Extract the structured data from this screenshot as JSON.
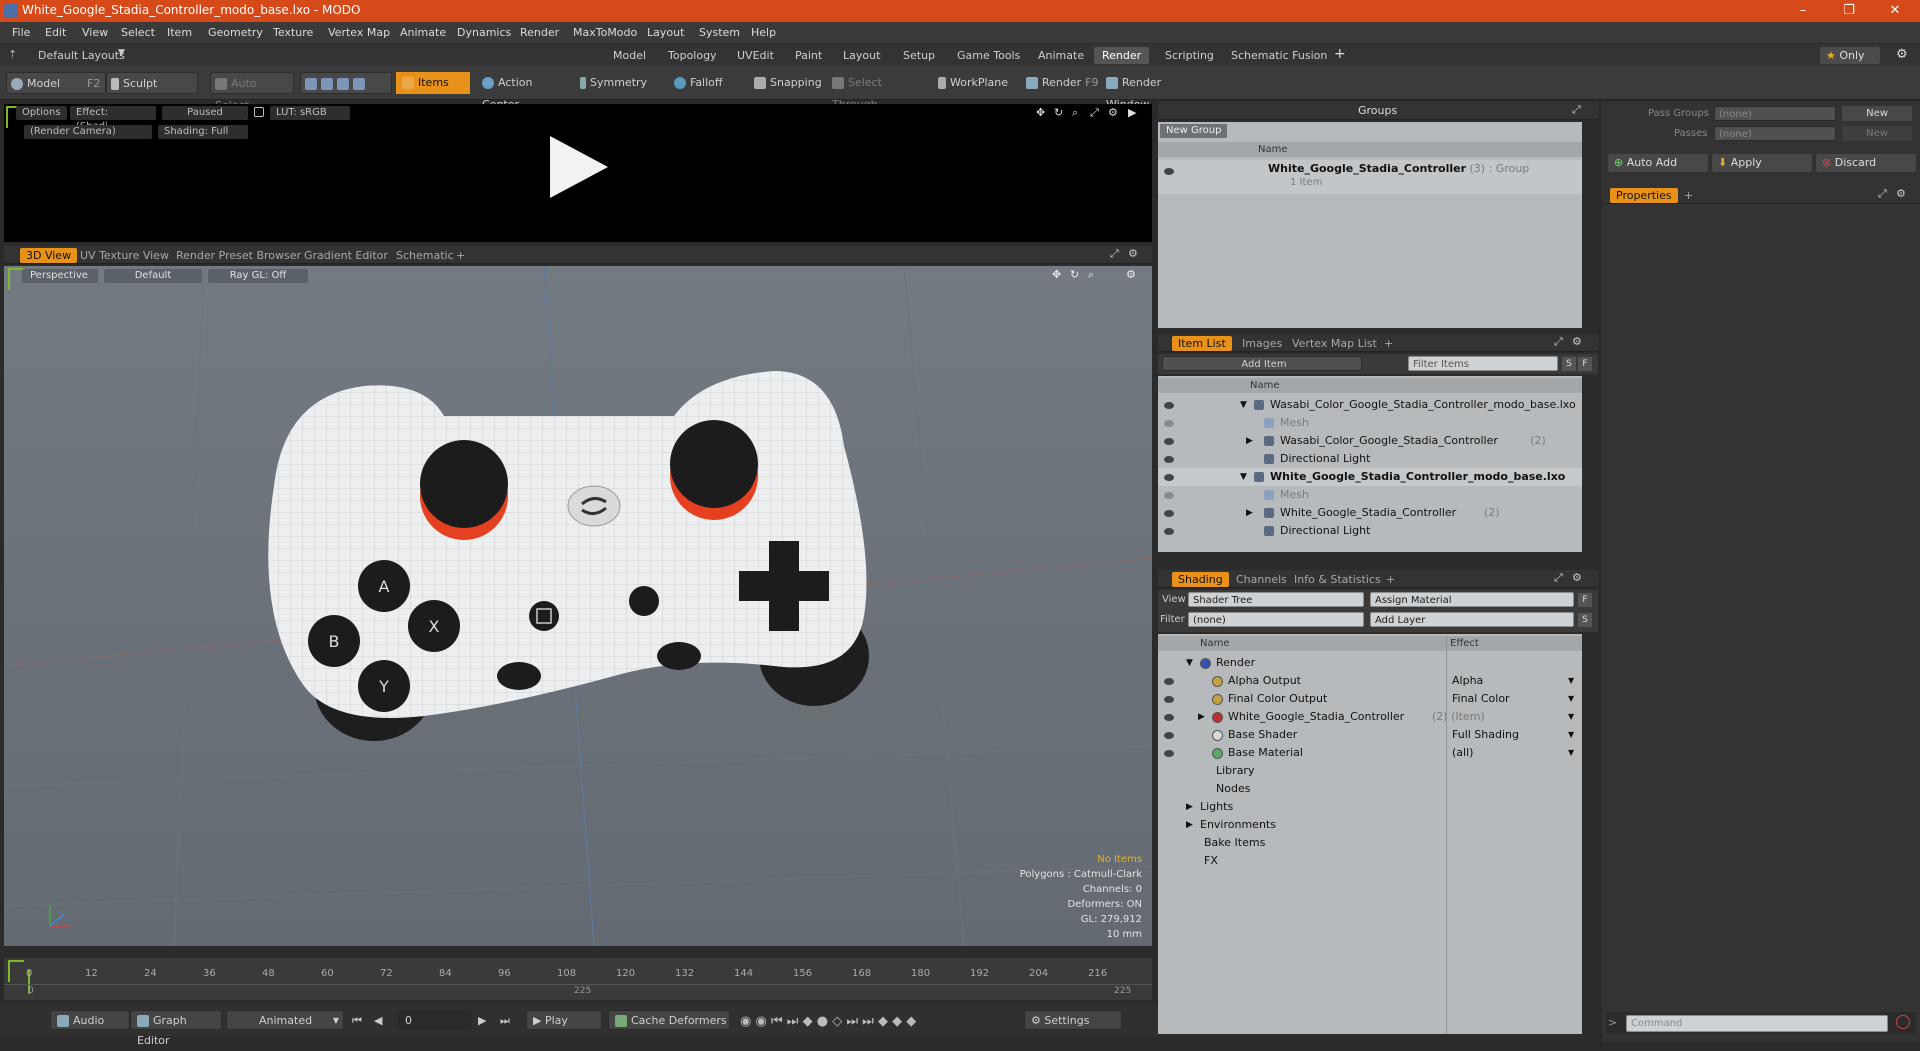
{
  "window": {
    "title": "White_Google_Stadia_Controller_modo_base.lxo - MODO",
    "minimize": "–",
    "restore": "❐",
    "close": "✕"
  },
  "menu": [
    "File",
    "Edit",
    "View",
    "Select",
    "Item",
    "Geometry",
    "Texture",
    "Vertex Map",
    "Animate",
    "Dynamics",
    "Render",
    "MaxToModo",
    "Layout",
    "System",
    "Help"
  ],
  "layouts": {
    "current": "Default Layouts",
    "tabs": [
      "Model",
      "Topology",
      "UVEdit",
      "Paint",
      "Layout",
      "Setup",
      "Game Tools",
      "Animate",
      "Render",
      "Scripting",
      "Schematic Fusion"
    ],
    "active": "Render",
    "plus": "+",
    "only": "Only"
  },
  "toolbar": {
    "model": "Model",
    "model_key": "F2",
    "sculpt": "Sculpt",
    "auto_select": "Auto Select",
    "items": "Items",
    "action_center": "Action Center",
    "symmetry": "Symmetry",
    "falloff": "Falloff",
    "snapping": "Snapping",
    "select_through": "Select Through",
    "workplane": "WorkPlane",
    "render": "Render",
    "render_key": "F9",
    "render_window": "Render Window"
  },
  "render_view": {
    "options": "Options",
    "effect": "Effect: (Shadi...",
    "paused": "Paused",
    "lut": "LUT: sRGB",
    "camera": "(Render Camera)",
    "shading": "Shading: Full"
  },
  "view_tabs": {
    "tabs": [
      "3D View",
      "UV Texture View",
      "Render Preset Browser",
      "Gradient Editor",
      "Schematic"
    ],
    "active": "3D View",
    "plus": "+"
  },
  "viewport": {
    "perspective": "Perspective",
    "default": "Default",
    "raygl": "Ray GL: Off",
    "hud": {
      "no_items": "No Items",
      "polygons": "Polygons : Catmull-Clark",
      "channels": "Channels: 0",
      "deformers": "Deformers: ON",
      "gl": "GL: 279,912",
      "scale": "10 mm"
    }
  },
  "timeline": {
    "ticks": [
      "0",
      "12",
      "24",
      "36",
      "48",
      "60",
      "72",
      "84",
      "96",
      "108",
      "120",
      "132",
      "144",
      "156",
      "168",
      "180",
      "192",
      "204",
      "216"
    ],
    "sub_ticks": [
      "0",
      "225",
      "225"
    ]
  },
  "bottom": {
    "audio": "Audio",
    "graph_editor": "Graph Editor",
    "animated": "Animated",
    "frame": "0",
    "play": "Play",
    "cache_deformers": "Cache Deformers",
    "settings": "Settings"
  },
  "groups": {
    "title": "Groups",
    "new_group": "New Group",
    "col_name": "Name",
    "row_name": "White_Google_Stadia_Controller",
    "row_count": "(3)",
    "row_type": ": Group",
    "row_sub": "1 Item"
  },
  "passes": {
    "pass_groups": "Pass Groups",
    "passes": "Passes",
    "none": "(none)",
    "new": "New",
    "auto_add": "Auto Add",
    "apply": "Apply",
    "discard": "Discard",
    "properties": "Properties",
    "plus": "+"
  },
  "item_list": {
    "tabs": [
      "Item List",
      "Images",
      "Vertex Map List"
    ],
    "active": "Item List",
    "plus": "+",
    "add_item": "Add Item",
    "filter": "Filter Items",
    "s": "S",
    "f": "F",
    "col_name": "Name",
    "rows": [
      {
        "name": "Wasabi_Color_Google_Stadia_Controller_modo_base.lxo",
        "indent": 0,
        "style": "normal",
        "arrow": "▼"
      },
      {
        "name": "Mesh",
        "indent": 1,
        "style": "gray",
        "arrow": ""
      },
      {
        "name": "Wasabi_Color_Google_Stadia_Controller",
        "count": "(2)",
        "indent": 1,
        "style": "normal",
        "arrow": "▶"
      },
      {
        "name": "Directional Light",
        "indent": 1,
        "style": "normal",
        "arrow": ""
      },
      {
        "name": "White_Google_Stadia_Controller_modo_base.lxo",
        "indent": 0,
        "style": "bold",
        "arrow": "▼"
      },
      {
        "name": "Mesh",
        "indent": 1,
        "style": "gray",
        "arrow": ""
      },
      {
        "name": "White_Google_Stadia_Controller",
        "count": "(2)",
        "indent": 1,
        "style": "normal",
        "arrow": "▶"
      },
      {
        "name": "Directional Light",
        "indent": 1,
        "style": "normal",
        "arrow": ""
      }
    ]
  },
  "shading": {
    "tabs": [
      "Shading",
      "Channels",
      "Info & Statistics"
    ],
    "active": "Shading",
    "plus": "+",
    "view_label": "View",
    "view_value": "Shader Tree",
    "assign_material": "Assign Material",
    "filter_label": "Filter",
    "filter_value": "(none)",
    "add_layer": "Add Layer",
    "f": "F",
    "s": "S",
    "col_name": "Name",
    "col_effect": "Effect",
    "rows": [
      {
        "name": "Render",
        "effect": "",
        "indent": 0,
        "arrow": "▼",
        "dot": "#3b4fb0",
        "eye": false
      },
      {
        "name": "Alpha Output",
        "effect": "Alpha",
        "indent": 1,
        "arrow": "",
        "dot": "#c8a040",
        "eye": true
      },
      {
        "name": "Final Color Output",
        "effect": "Final Color",
        "indent": 1,
        "arrow": "",
        "dot": "#c8a040",
        "eye": true
      },
      {
        "name": "White_Google_Stadia_Controller",
        "count": "(2) (Item)",
        "effect": "",
        "indent": 1,
        "arrow": "▶",
        "dot": "#c03030",
        "eye": true
      },
      {
        "name": "Base Shader",
        "effect": "Full Shading",
        "indent": 1,
        "arrow": "",
        "dot": "#d8d8d8",
        "eye": true
      },
      {
        "name": "Base Material",
        "effect": "(all)",
        "indent": 1,
        "arrow": "",
        "dot": "#5aa860",
        "eye": true
      },
      {
        "name": "Library",
        "effect": "",
        "indent": 1,
        "arrow": "",
        "dot": "",
        "eye": false
      },
      {
        "name": "Nodes",
        "effect": "",
        "indent": 1,
        "arrow": "",
        "dot": "",
        "eye": false
      },
      {
        "name": "Lights",
        "effect": "",
        "indent": 0,
        "arrow": "▶",
        "dot": "",
        "eye": false
      },
      {
        "name": "Environments",
        "effect": "",
        "indent": 0,
        "arrow": "▶",
        "dot": "",
        "eye": false
      },
      {
        "name": "Bake Items",
        "effect": "",
        "indent": 0,
        "arrow": "",
        "dot": "",
        "eye": false
      },
      {
        "name": "FX",
        "effect": "",
        "indent": 0,
        "arrow": "",
        "dot": "",
        "eye": false
      }
    ]
  },
  "command": {
    "placeholder": "Command"
  },
  "controller_labels": {
    "a": "A",
    "b": "B",
    "x": "X",
    "y": "Y"
  }
}
